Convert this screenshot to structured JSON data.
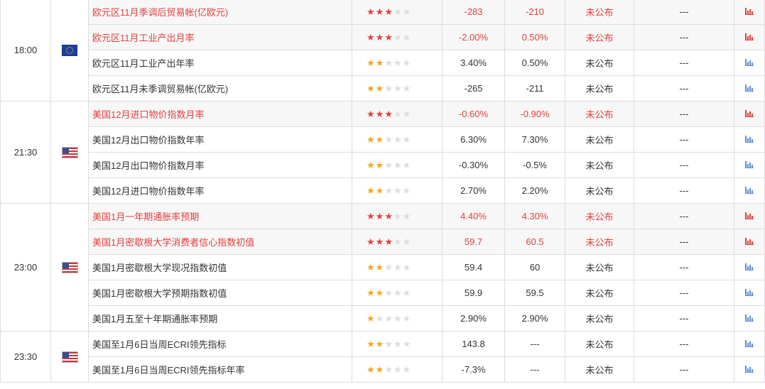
{
  "groups": [
    {
      "time": "18:00",
      "flag": "eu-flag-icon",
      "rows": [
        {
          "name": "欧元区11月季调后贸易帐(亿欧元)",
          "stars": 3,
          "highlight": true,
          "previous": "-283",
          "forecast": "-210",
          "actual": "未公布",
          "impact": "---"
        },
        {
          "name": "欧元区11月工业产出月率",
          "stars": 3,
          "highlight": true,
          "previous": "-2.00%",
          "forecast": "0.50%",
          "actual": "未公布",
          "impact": "---"
        },
        {
          "name": "欧元区11月工业产出年率",
          "stars": 2,
          "highlight": false,
          "previous": "3.40%",
          "forecast": "0.50%",
          "actual": "未公布",
          "impact": "---"
        },
        {
          "name": "欧元区11月未季调贸易帐(亿欧元)",
          "stars": 2,
          "highlight": false,
          "previous": "-265",
          "forecast": "-211",
          "actual": "未公布",
          "impact": "---"
        }
      ]
    },
    {
      "time": "21:30",
      "flag": "us-flag-icon",
      "rows": [
        {
          "name": "美国12月进口物价指数月率",
          "stars": 3,
          "highlight": true,
          "previous": "-0.60%",
          "forecast": "-0.90%",
          "actual": "未公布",
          "impact": "---"
        },
        {
          "name": "美国12月出口物价指数年率",
          "stars": 2,
          "highlight": false,
          "previous": "6.30%",
          "forecast": "7.30%",
          "actual": "未公布",
          "impact": "---"
        },
        {
          "name": "美国12月出口物价指数月率",
          "stars": 2,
          "highlight": false,
          "previous": "-0.30%",
          "forecast": "-0.5%",
          "actual": "未公布",
          "impact": "---"
        },
        {
          "name": "美国12月进口物价指数年率",
          "stars": 2,
          "highlight": false,
          "previous": "2.70%",
          "forecast": "2.20%",
          "actual": "未公布",
          "impact": "---"
        }
      ]
    },
    {
      "time": "23:00",
      "flag": "us-flag-icon",
      "rows": [
        {
          "name": "美国1月一年期通胀率预期",
          "stars": 3,
          "highlight": true,
          "previous": "4.40%",
          "forecast": "4.30%",
          "actual": "未公布",
          "impact": "---"
        },
        {
          "name": "美国1月密歇根大学消费者信心指数初值",
          "stars": 3,
          "highlight": true,
          "previous": "59.7",
          "forecast": "60.5",
          "actual": "未公布",
          "impact": "---"
        },
        {
          "name": "美国1月密歇根大学现况指数初值",
          "stars": 2,
          "highlight": false,
          "previous": "59.4",
          "forecast": "60",
          "actual": "未公布",
          "impact": "---"
        },
        {
          "name": "美国1月密歇根大学预期指数初值",
          "stars": 2,
          "highlight": false,
          "previous": "59.9",
          "forecast": "59.5",
          "actual": "未公布",
          "impact": "---"
        },
        {
          "name": "美国1月五至十年期通胀率预期",
          "stars": 1,
          "highlight": false,
          "previous": "2.90%",
          "forecast": "2.90%",
          "actual": "未公布",
          "impact": "---"
        }
      ]
    },
    {
      "time": "23:30",
      "flag": "us-flag-icon",
      "rows": [
        {
          "name": "美国至1月6日当周ECRI领先指标",
          "stars": 2,
          "highlight": false,
          "previous": "143.8",
          "forecast": "---",
          "actual": "未公布",
          "impact": "---"
        },
        {
          "name": "美国至1月6日当周ECRI领先指标年率",
          "stars": 2,
          "highlight": false,
          "previous": "-7.3%",
          "forecast": "---",
          "actual": "未公布",
          "impact": "---"
        }
      ]
    }
  ],
  "colors": {
    "highlight_text": "#e2403e",
    "star_on": "#f1a91d",
    "star_off": "#dddddd",
    "chart_icon": "#5b8ed8"
  }
}
